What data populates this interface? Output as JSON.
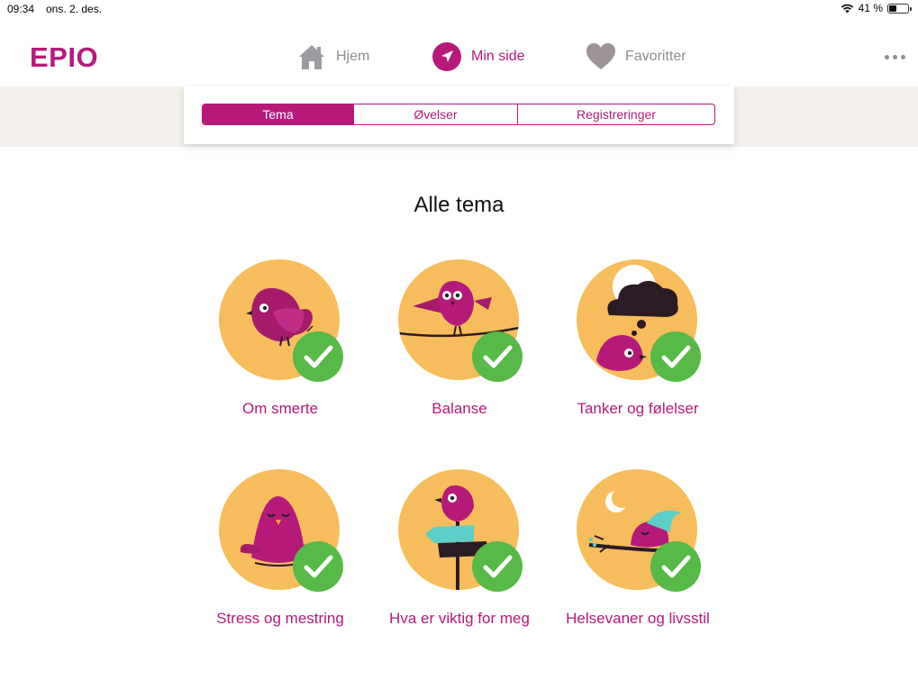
{
  "status_bar": {
    "time": "09:34",
    "date": "ons. 2. des.",
    "battery_label": "41 %",
    "battery_level": 0.41
  },
  "app": {
    "logo": "EPIO"
  },
  "nav": {
    "home_label": "Hjem",
    "min_side_label": "Min side",
    "favorites_label": "Favoritter",
    "icons": {
      "home": "home-icon",
      "min_side": "location-arrow-icon",
      "favorites": "heart-icon",
      "more": "more-dots-icon"
    },
    "active": "Min side"
  },
  "segments": [
    {
      "label": "Tema",
      "active": true
    },
    {
      "label": "Øvelser",
      "active": false
    },
    {
      "label": "Registreringer",
      "active": false
    }
  ],
  "section_title": "Alle tema",
  "topics": [
    {
      "label": "Om smerte",
      "completed": true
    },
    {
      "label": "Balanse",
      "completed": true
    },
    {
      "label": "Tanker og følelser",
      "completed": true
    },
    {
      "label": "Stress og mestring",
      "completed": true
    },
    {
      "label": "Hva er viktig for meg",
      "completed": true
    },
    {
      "label": "Helsevaner og livsstil",
      "completed": true
    }
  ],
  "colors": {
    "brand": "#b51a7b",
    "tile_bg": "#f7bd5c",
    "check": "#57b947",
    "band": "#f4f1ed",
    "inactive_nav": "#8e8e93"
  }
}
